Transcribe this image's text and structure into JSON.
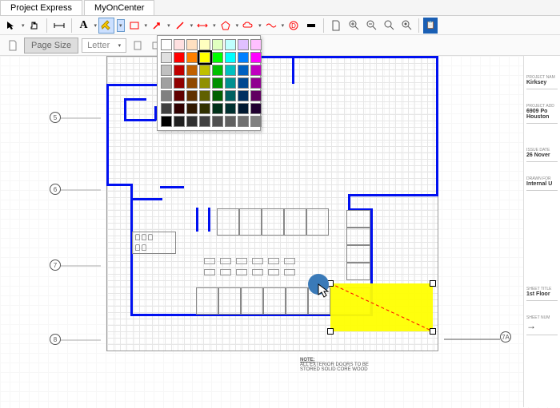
{
  "tabs": {
    "project_express": "Project Express",
    "my_on_center": "MyOnCenter"
  },
  "subbar": {
    "page_size": "Page Size",
    "letter": "Letter"
  },
  "toolbar_icons": {
    "pointer": "pointer",
    "hand": "hand",
    "measure": "measure",
    "text": "A",
    "highlighter": "✎",
    "shapes": "▭",
    "arrow": "↗",
    "line": "╱",
    "dim": "dim",
    "cloud": "cloud",
    "freehand": "∿",
    "circle": "○",
    "stamp": "⊕",
    "redact": "▬",
    "doc": "doc",
    "zoomin": "⊕",
    "zoomout": "⊖",
    "zoomfit": "⊙",
    "zoom100": "⊚",
    "clip": "⊡"
  },
  "axis": {
    "labels": [
      "5",
      "6",
      "7",
      "8"
    ]
  },
  "info": {
    "project_name_label": "PROJECT NAM",
    "project_name": "Kirksey",
    "project_addr_label": "PROJECT ADD",
    "project_addr_1": "6909 Po",
    "project_addr_2": "Houston",
    "issue_date_label": "ISSUE DATE",
    "issue_date": "26 Nover",
    "drawn_for_label": "DRAWN FOR",
    "drawn_for": "Internal U",
    "sheet_title_label": "SHEET TITLE",
    "sheet_title": "1st Floor",
    "sheet_num_label": "SHEET NUM",
    "sheet_arrow": "→"
  },
  "note": {
    "title": "NOTE:",
    "line1": "ALL EXTERIOR DOORS TO BE",
    "line2": "STORED SOLID CORE WOOD"
  },
  "key_mark": "7A",
  "color_picker": {
    "rows": [
      [
        "#ffffff",
        "#ffe0e0",
        "#ffe0c0",
        "#ffffc0",
        "#e0ffc0",
        "#c0ffff",
        "#e0c0ff",
        "#ffc0ff"
      ],
      [
        "#e0e0e0",
        "#ff0000",
        "#ff8000",
        "#ffff00",
        "#00ff00",
        "#00ffff",
        "#0080ff",
        "#ff00ff"
      ],
      [
        "#c0c0c0",
        "#c00000",
        "#c06000",
        "#c0c000",
        "#00c000",
        "#00c0c0",
        "#0060c0",
        "#c000c0"
      ],
      [
        "#a0a0a0",
        "#900000",
        "#904800",
        "#909000",
        "#009000",
        "#009090",
        "#004890",
        "#900090"
      ],
      [
        "#808080",
        "#600000",
        "#603000",
        "#606000",
        "#006000",
        "#006060",
        "#003060",
        "#600060"
      ],
      [
        "#404040",
        "#300000",
        "#301800",
        "#303000",
        "#003018",
        "#003030",
        "#001830",
        "#200030"
      ],
      [
        "#000000",
        "#202020",
        "#303030",
        "#404040",
        "#505050",
        "#606060",
        "#707070",
        "#808080"
      ]
    ],
    "selected": [
      1,
      3
    ]
  },
  "chart_data": null
}
